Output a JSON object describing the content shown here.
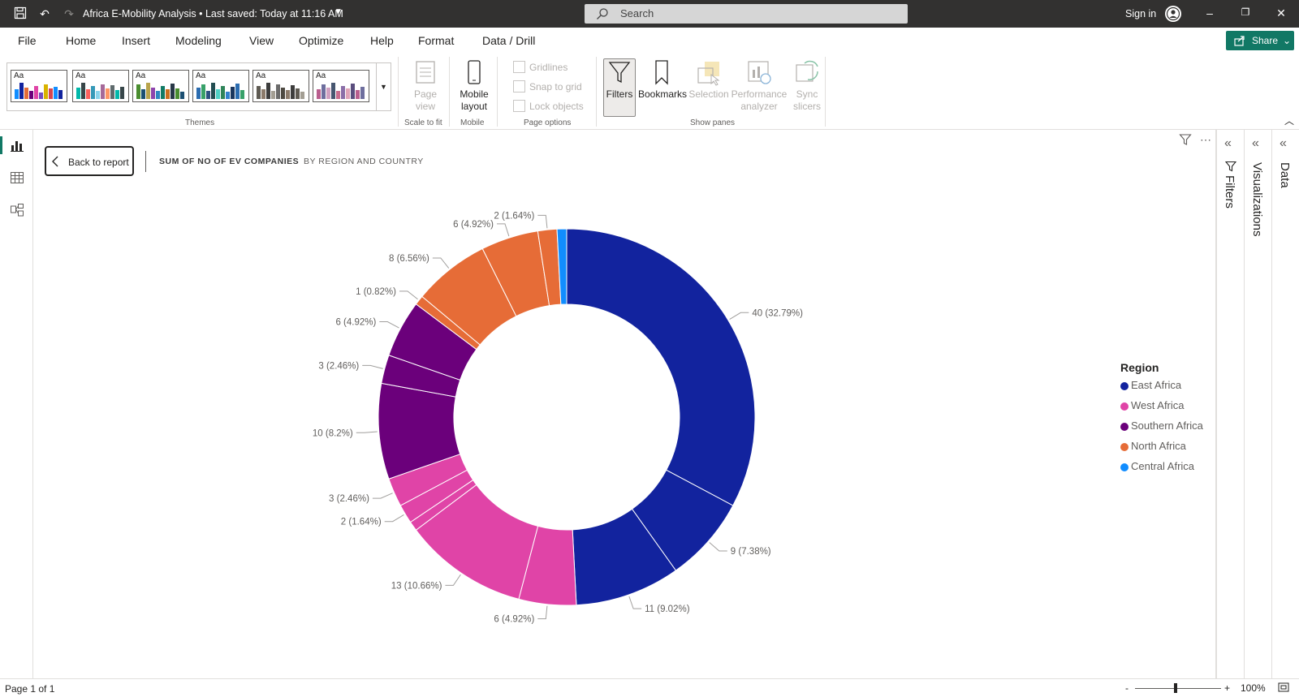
{
  "titlebar": {
    "doc_title": "Africa E-Mobility Analysis • Last saved: Today at 11:16 AM",
    "search_placeholder": "Search",
    "signin": "Sign in"
  },
  "menu": {
    "tabs": [
      "File",
      "Home",
      "Insert",
      "Modeling",
      "View",
      "Optimize",
      "Help",
      "Format",
      "Data / Drill"
    ],
    "active": "View",
    "share": "Share"
  },
  "ribbon": {
    "themes_label": "Themes",
    "page_view": "Page view",
    "scale_to_fit": "Scale to fit",
    "mobile_layout": "Mobile layout",
    "mobile_label": "Mobile",
    "gridlines": "Gridlines",
    "snap_to_grid": "Snap to grid",
    "lock_objects": "Lock objects",
    "page_options": "Page options",
    "filters": "Filters",
    "bookmarks": "Bookmarks",
    "selection": "Selection",
    "performance_analyzer": "Performance analyzer",
    "sync_slicers": "Sync slicers",
    "show_panes": "Show panes"
  },
  "canvas": {
    "back_label": "Back to report",
    "crumb_measure": "SUM OF NO OF EV COMPANIES",
    "crumb_by": "BY REGION AND COUNTRY"
  },
  "chart_data": {
    "type": "pie",
    "hole": true,
    "legend_title": "Region",
    "legend_position": "right",
    "legend": [
      {
        "name": "East Africa",
        "color": "#12239e"
      },
      {
        "name": "West Africa",
        "color": "#e044a7"
      },
      {
        "name": "Southern Africa",
        "color": "#6b007b"
      },
      {
        "name": "North Africa",
        "color": "#e66c37"
      },
      {
        "name": "Central Africa",
        "color": "#118dff"
      }
    ],
    "slices": [
      {
        "region": "East Africa",
        "value": 40,
        "label": "40 (32.79%)"
      },
      {
        "region": "East Africa",
        "value": 9,
        "label": "9 (7.38%)"
      },
      {
        "region": "East Africa",
        "value": 11,
        "label": "11 (9.02%)"
      },
      {
        "region": "West Africa",
        "value": 6,
        "label": "6 (4.92%)"
      },
      {
        "region": "West Africa",
        "value": 13,
        "label": "13 (10.66%)"
      },
      {
        "region": "West Africa",
        "value": 1,
        "label": ""
      },
      {
        "region": "West Africa",
        "value": 2,
        "label": "2 (1.64%)"
      },
      {
        "region": "West Africa",
        "value": 3,
        "label": "3 (2.46%)"
      },
      {
        "region": "Southern Africa",
        "value": 10,
        "label": "10 (8.2%)"
      },
      {
        "region": "Southern Africa",
        "value": 3,
        "label": "3 (2.46%)"
      },
      {
        "region": "Southern Africa",
        "value": 6,
        "label": "6 (4.92%)"
      },
      {
        "region": "North Africa",
        "value": 1,
        "label": "1 (0.82%)"
      },
      {
        "region": "North Africa",
        "value": 8,
        "label": "8 (6.56%)"
      },
      {
        "region": "North Africa",
        "value": 6,
        "label": "6 (4.92%)"
      },
      {
        "region": "North Africa",
        "value": 2,
        "label": "2 (1.64%)"
      },
      {
        "region": "Central Africa",
        "value": 1,
        "label": ""
      }
    ]
  },
  "panes": {
    "filters": "Filters",
    "visualizations": "Visualizations",
    "data": "Data"
  },
  "status": {
    "page": "Page 1 of 1",
    "zoom": "100%"
  }
}
